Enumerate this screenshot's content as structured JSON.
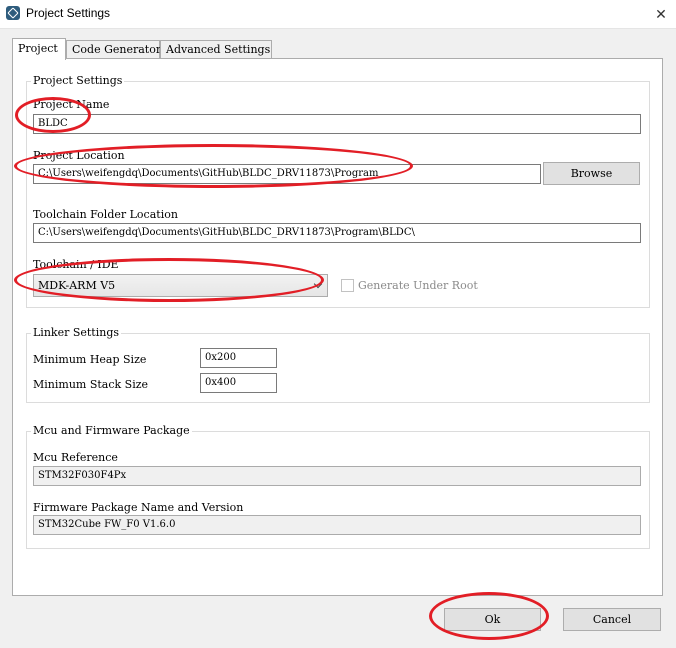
{
  "window": {
    "title": "Project Settings",
    "close_glyph": "✕"
  },
  "tabs": [
    {
      "label": "Project",
      "active": true
    },
    {
      "label": "Code Generator",
      "active": false
    },
    {
      "label": "Advanced Settings",
      "active": false
    }
  ],
  "project_settings": {
    "group_title": "Project Settings",
    "project_name_label": "Project Name",
    "project_name_value": "BLDC",
    "project_location_label": "Project Location",
    "project_location_value": "C:\\Users\\weifengdq\\Documents\\GitHub\\BLDC_DRV11873\\Program",
    "browse_label": "Browse",
    "toolchain_folder_label": "Toolchain Folder Location",
    "toolchain_folder_value": "C:\\Users\\weifengdq\\Documents\\GitHub\\BLDC_DRV11873\\Program\\BLDC\\",
    "toolchain_ide_label": "Toolchain / IDE",
    "toolchain_ide_value": "MDK-ARM V5",
    "generate_under_root_label": "Generate Under Root",
    "generate_under_root_checked": false
  },
  "linker_settings": {
    "group_title": "Linker Settings",
    "min_heap_label": "Minimum Heap Size",
    "min_heap_value": "0x200",
    "min_stack_label": "Minimum Stack Size",
    "min_stack_value": "0x400"
  },
  "mcu_firmware": {
    "group_title": "Mcu and Firmware Package",
    "mcu_reference_label": "Mcu Reference",
    "mcu_reference_value": "STM32F030F4Px",
    "firmware_label": "Firmware Package Name and Version",
    "firmware_value": "STM32Cube FW_F0 V1.6.0"
  },
  "footer": {
    "ok_label": "Ok",
    "cancel_label": "Cancel"
  },
  "colors": {
    "annotation_ring": "#e21e26",
    "app_icon": "#2e5c7d"
  },
  "icons": {
    "app": "app-icon",
    "close": "close-icon",
    "dropdown": "chevron-down-icon"
  }
}
